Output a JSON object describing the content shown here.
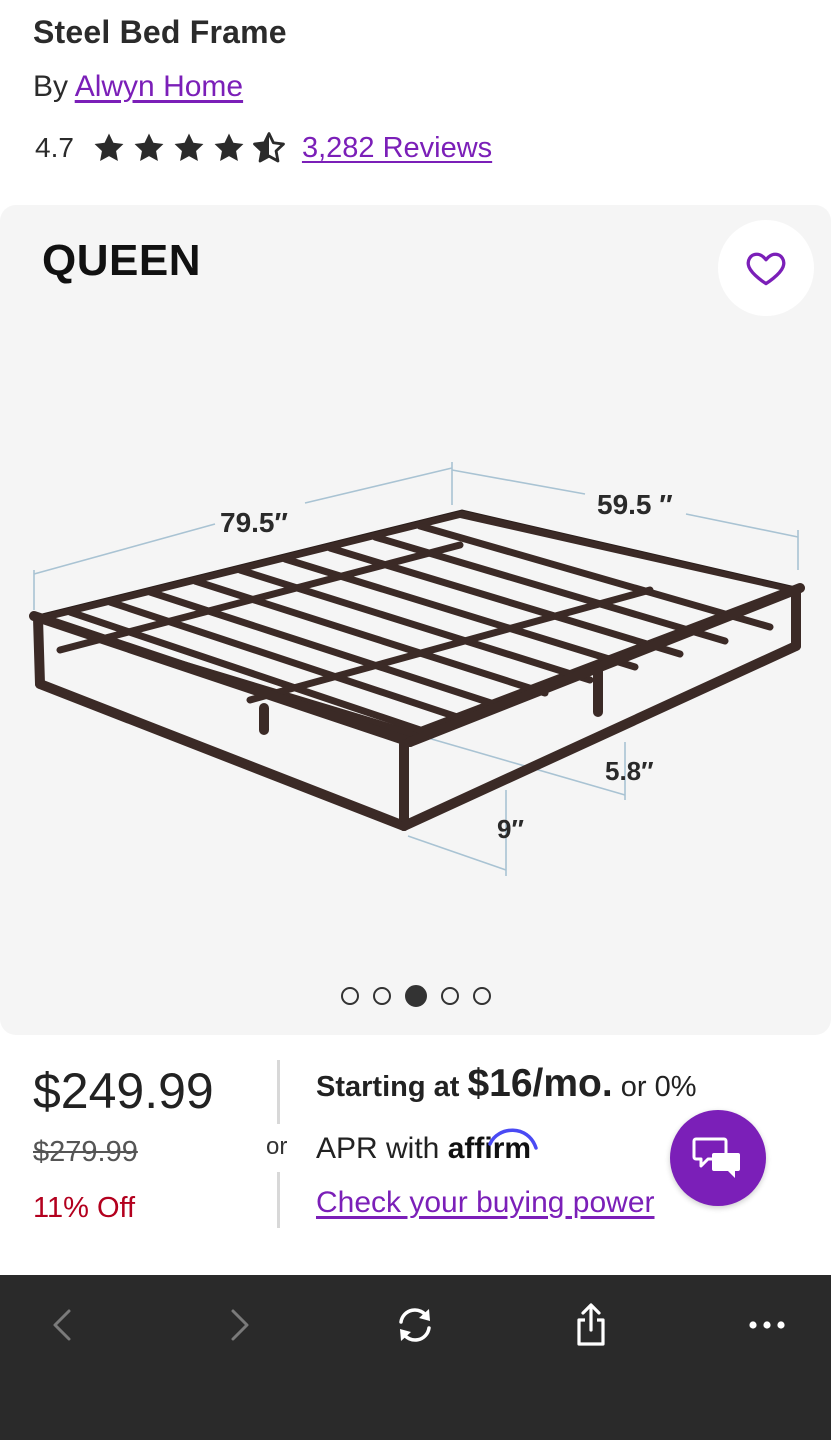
{
  "product": {
    "title": "Steel Bed Frame",
    "by_prefix": "By",
    "brand": "Alwyn Home",
    "rating": "4.7",
    "rating_stars": 4.5,
    "reviews_label": "3,282 Reviews"
  },
  "gallery": {
    "size_label": "QUEEN",
    "favorite_icon": "heart-icon",
    "dimensions": {
      "length": "79.5″",
      "width": "59.5 ″",
      "clearance": "5.8″",
      "height": "9″"
    },
    "image_count": 5,
    "active_image_index": 2
  },
  "pricing": {
    "price": "$249.99",
    "original_price": "$279.99",
    "discount": "11% Off",
    "or_label": "or",
    "financing_prefix": "Starting at",
    "financing_amount": "$16/mo.",
    "financing_suffix": "or 0%",
    "financing_line2": "APR with",
    "financing_brand": "affirm",
    "buying_power_link": "Check your buying power"
  },
  "chat": {
    "icon": "chat-bubbles-icon"
  },
  "browser_toolbar": {
    "icons": [
      "back-icon",
      "forward-icon",
      "reload-icon",
      "share-icon",
      "more-icon"
    ]
  },
  "colors": {
    "accent": "#7b1fb8",
    "discount": "#b3001e",
    "toolbar_bg": "#2a2a2a",
    "gallery_bg": "#f5f5f5",
    "star": "#2b2b2b"
  }
}
